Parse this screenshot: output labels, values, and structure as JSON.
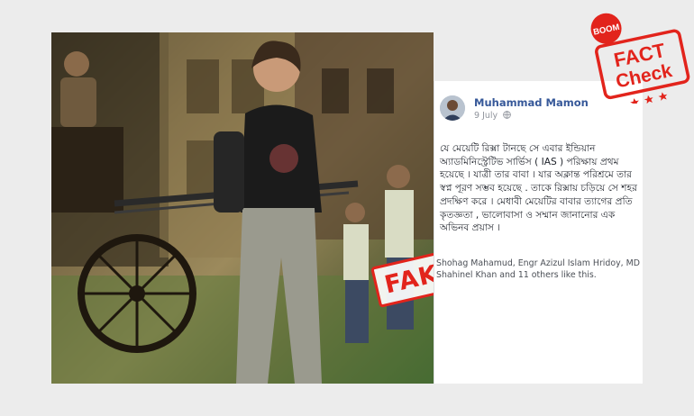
{
  "photo": {
    "alt": "Young woman pulling a hand-drawn rickshaw on a street",
    "fake_label": "FAKE"
  },
  "post": {
    "author": "Muhammad Mamon",
    "date": "9 July",
    "privacy_icon": "globe-icon",
    "text": "যে মেয়েটি রিক্সা টানছে সে এবার ইন্ডিয়ান অ্যাডমিনিস্ট্রেটিভ সার্ভিস ( IAS ) পরিক্ষায় প্রথম হয়েছে । যাত্রী তার বাবা । যার অক্লান্ত পরিশ্রমে তার স্বপ্ন পূরণ সম্ভব হয়েছে . তাকে রিক্সায় চড়িয়ে সে শহর প্রদক্ষিণ করে । মেধাবী মেয়েটির বাবার ত্যাগের প্রতি কৃতজ্ঞতা , ভালোবাসা ও সম্মান জানানোর এক অভিনব প্রয়াস ।",
    "likes": "Shohag Mahamud, Engr Azizul Islam Hridoy, MD Shahinel Khan and 11 others like this."
  },
  "badge": {
    "top": "BOOM",
    "line1": "FACT",
    "line2": "Check",
    "color": "#e2241c"
  }
}
